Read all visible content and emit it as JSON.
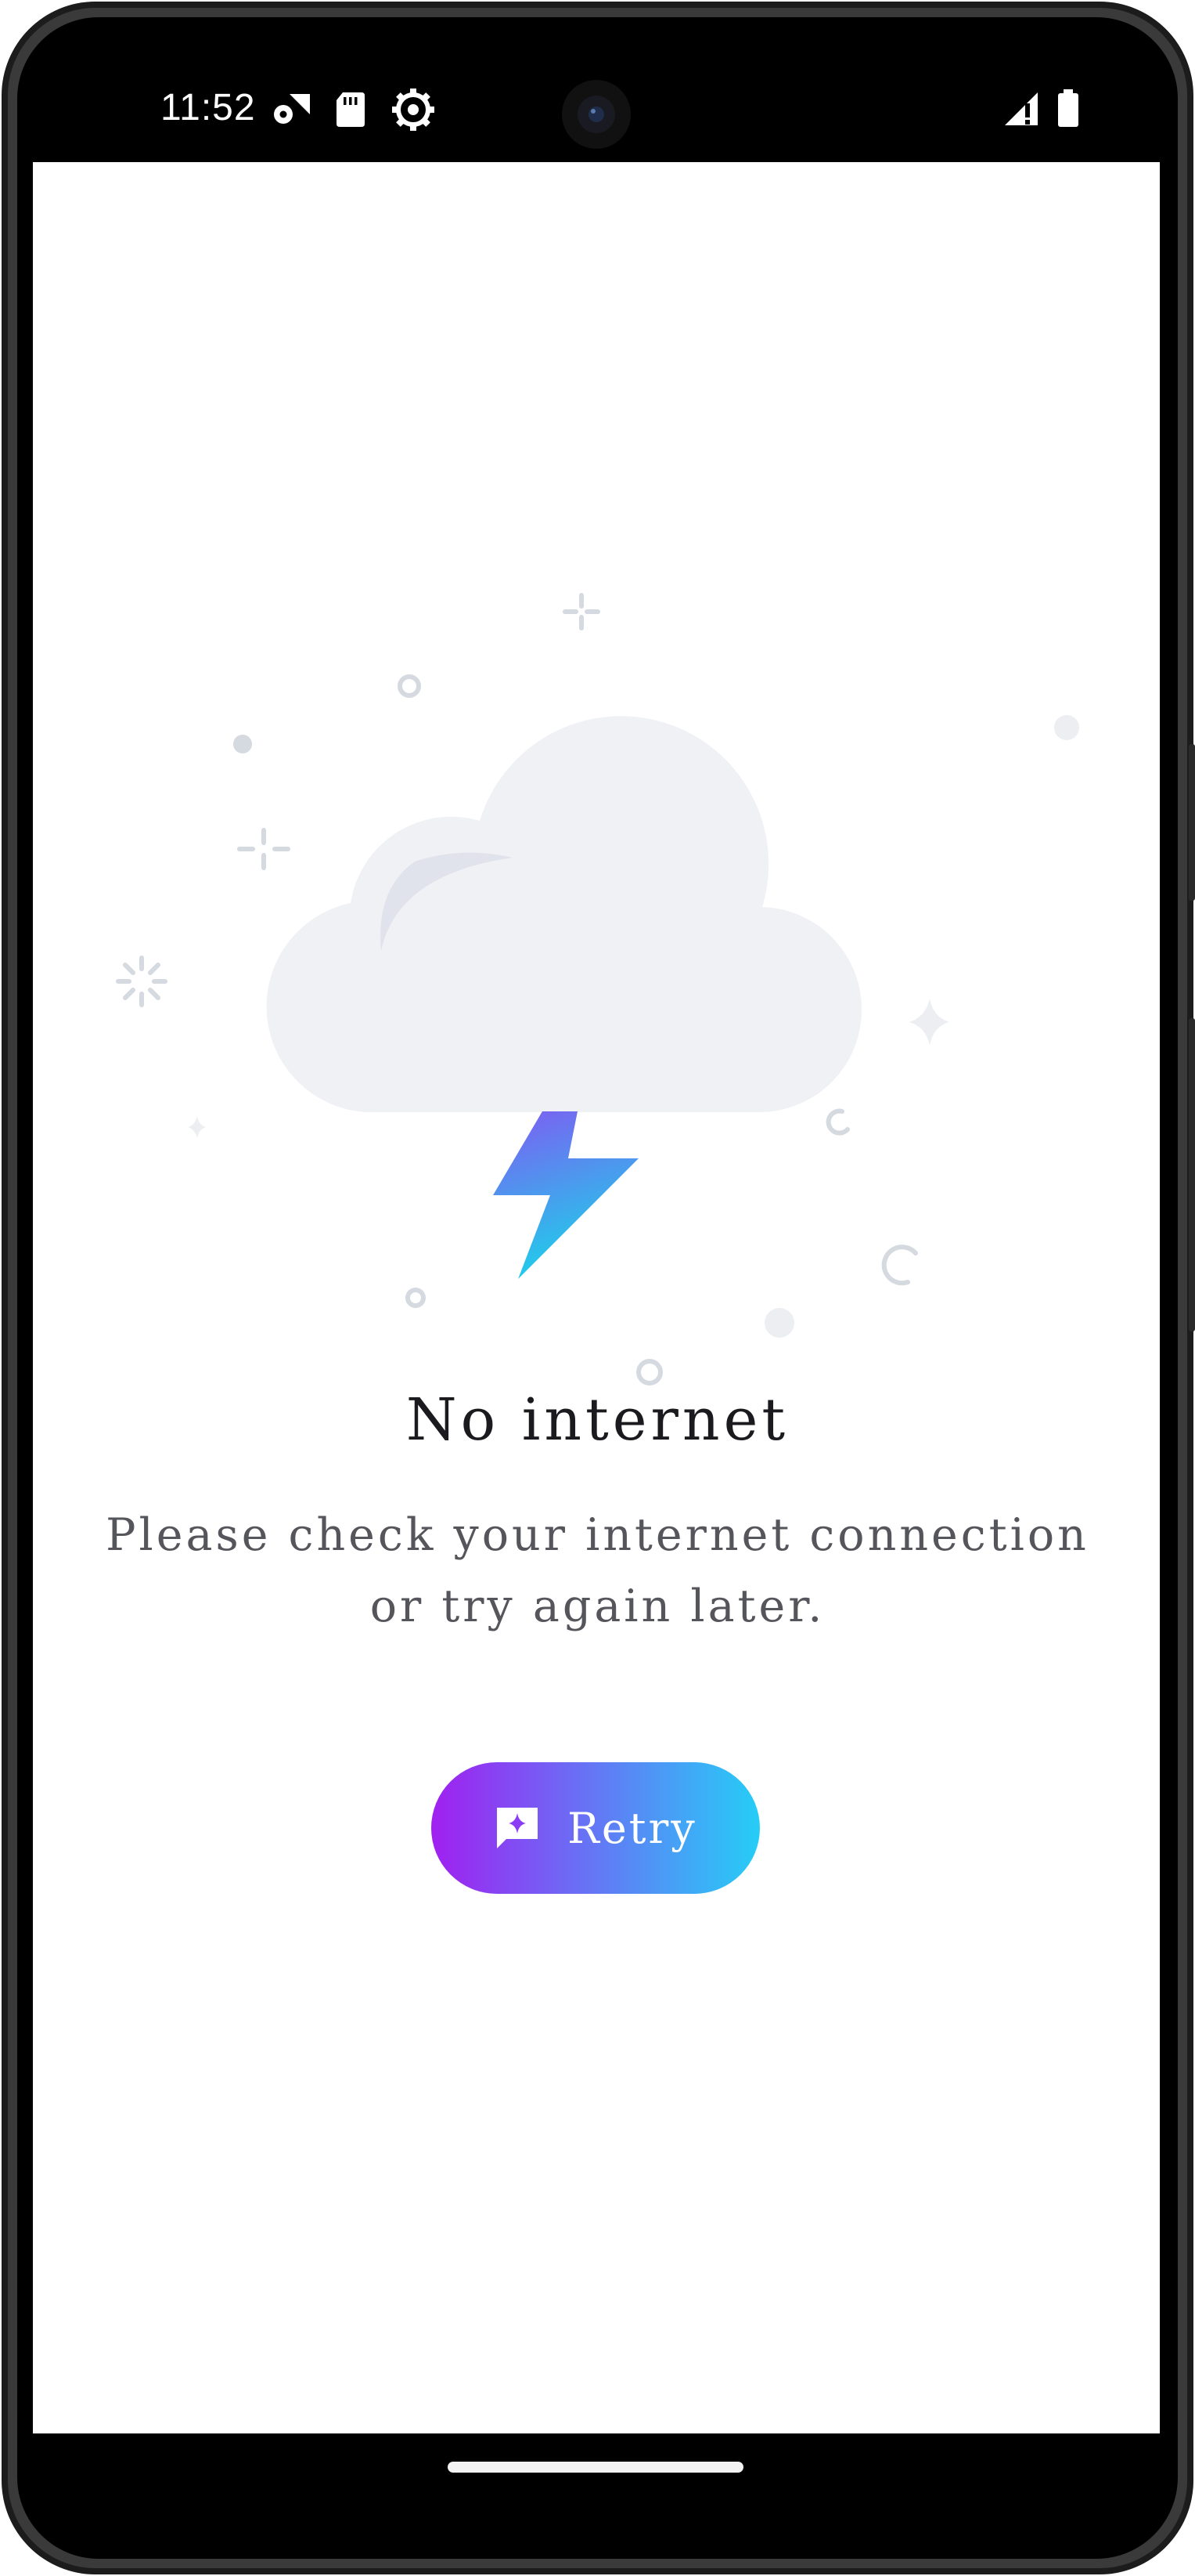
{
  "status_bar": {
    "time": "11:52",
    "left_icons": [
      "settings-badge-icon",
      "sd-card-icon",
      "gear-icon"
    ],
    "right_icons": [
      "signal-icon",
      "battery-icon"
    ]
  },
  "empty_state": {
    "illustration": "cloud-lightning-icon",
    "title": "No internet",
    "message_line1": "Please check your internet connection",
    "message_line2": "or try again later."
  },
  "retry_button": {
    "label": "Retry",
    "icon": "sparkle-chat-icon"
  },
  "colors": {
    "gradient_start": "#a020f0",
    "gradient_end": "#26cdf6",
    "cloud": "#f0f1f5",
    "decoration": "#d5d9e0"
  }
}
